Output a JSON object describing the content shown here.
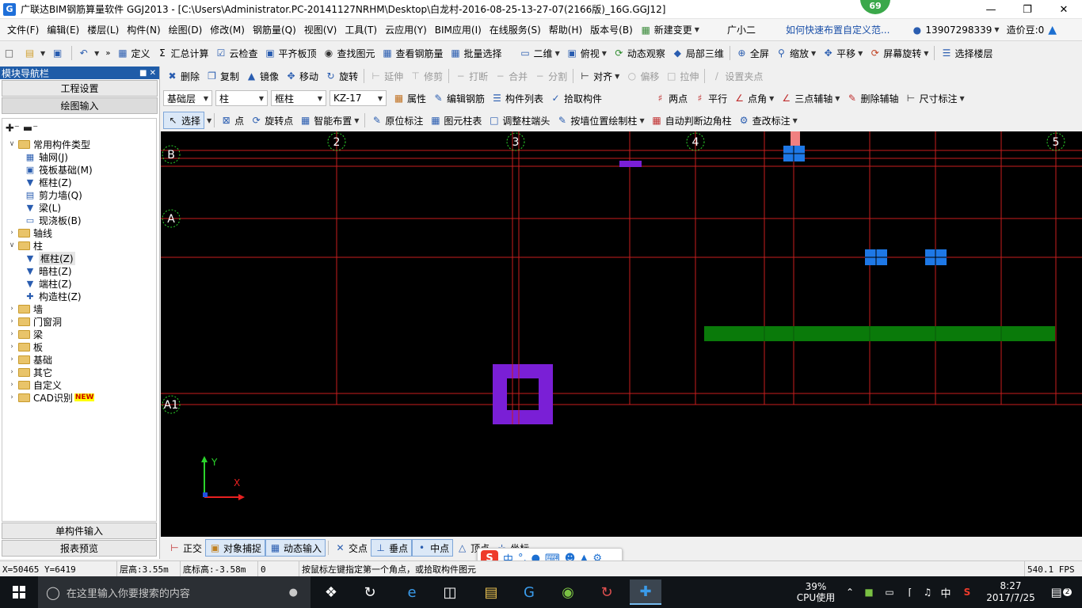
{
  "window": {
    "title": "广联达BIM钢筋算量软件 GGJ2013 - [C:\\Users\\Administrator.PC-20141127NRHM\\Desktop\\白龙村-2016-08-25-13-27-07(2166版)_16G.GGJ12]",
    "app_icon_glyph": "G",
    "badge": "69"
  },
  "menu": {
    "items": [
      "文件(F)",
      "编辑(E)",
      "楼层(L)",
      "构件(N)",
      "绘图(D)",
      "修改(M)",
      "钢筋量(Q)",
      "视图(V)",
      "工具(T)",
      "云应用(Y)",
      "BIM应用(I)",
      "在线服务(S)",
      "帮助(H)",
      "版本号(B)"
    ],
    "new_change": "新建变更",
    "assistant": "广小二",
    "tip_link": "如何快速布置自定义范...",
    "phone": "13907298339",
    "cost_beans": "造价豆:0"
  },
  "toolbar1": {
    "define": "定义",
    "calc": "汇总计算",
    "cloud_check": "云检查",
    "flat_top": "平齐板顶",
    "find": "查找图元",
    "view_rebar": "查看钢筋量",
    "batch_select": "批量选择",
    "view2d": "二维",
    "top_view": "俯视",
    "dyn_observe": "动态观察",
    "local3d": "局部三维",
    "fullscreen": "全屏",
    "zoom": "缩放",
    "pan": "平移",
    "rotate_screen": "屏幕旋转",
    "select_floor": "选择楼层"
  },
  "toolbar2": {
    "delete": "删除",
    "copy": "复制",
    "mirror": "镜像",
    "move": "移动",
    "rotate": "旋转",
    "extend": "延伸",
    "trim": "修剪",
    "break": "打断",
    "merge": "合并",
    "split": "分割",
    "align": "对齐",
    "offset": "偏移",
    "stretch": "拉伸",
    "set_grip": "设置夹点"
  },
  "toolbar3": {
    "floor": "基础层",
    "comp_type": "柱",
    "comp_sub": "框柱",
    "comp_name": "KZ-17",
    "props": "属性",
    "edit_rebar": "编辑钢筋",
    "comp_list": "构件列表",
    "pick": "拾取构件",
    "two_pts": "两点",
    "parallel": "平行",
    "pt_angle": "点角",
    "three_pt_axis": "三点辅轴",
    "del_aux": "删除辅轴",
    "dim": "尺寸标注"
  },
  "toolbar4": {
    "select": "选择",
    "point": "点",
    "rotate_point": "旋转点",
    "smart_layout": "智能布置",
    "in_place_mark": "原位标注",
    "elem_table": "图元柱表",
    "adjust_col_end": "调整柱端头",
    "draw_by_wall": "按墙位置绘制柱",
    "auto_corner": "自动判断边角柱",
    "modify_mark": "查改标注"
  },
  "nav": {
    "header": "模块导航栏",
    "tabs": [
      "工程设置",
      "绘图输入"
    ],
    "tree": [
      {
        "label": "常用构件类型",
        "level": 0,
        "kind": "folder",
        "expanded": true
      },
      {
        "label": "轴网(J)",
        "level": 1,
        "kind": "comp",
        "icon": "grid-icon"
      },
      {
        "label": "筏板基础(M)",
        "level": 1,
        "kind": "comp",
        "icon": "raft-icon"
      },
      {
        "label": "框柱(Z)",
        "level": 1,
        "kind": "comp",
        "icon": "column-icon"
      },
      {
        "label": "剪力墙(Q)",
        "level": 1,
        "kind": "comp",
        "icon": "wall-icon"
      },
      {
        "label": "梁(L)",
        "level": 1,
        "kind": "comp",
        "icon": "beam-icon"
      },
      {
        "label": "现浇板(B)",
        "level": 1,
        "kind": "comp",
        "icon": "slab-icon"
      },
      {
        "label": "轴线",
        "level": 0,
        "kind": "folder",
        "expanded": false
      },
      {
        "label": "柱",
        "level": 0,
        "kind": "folder",
        "expanded": true
      },
      {
        "label": "框柱(Z)",
        "level": 1,
        "kind": "comp",
        "icon": "column-icon",
        "selected": true
      },
      {
        "label": "暗柱(Z)",
        "level": 1,
        "kind": "comp",
        "icon": "column-icon"
      },
      {
        "label": "端柱(Z)",
        "level": 1,
        "kind": "comp",
        "icon": "column-icon"
      },
      {
        "label": "构造柱(Z)",
        "level": 1,
        "kind": "comp",
        "icon": "construct-column-icon"
      },
      {
        "label": "墙",
        "level": 0,
        "kind": "folder",
        "expanded": false
      },
      {
        "label": "门窗洞",
        "level": 0,
        "kind": "folder",
        "expanded": false
      },
      {
        "label": "梁",
        "level": 0,
        "kind": "folder",
        "expanded": false
      },
      {
        "label": "板",
        "level": 0,
        "kind": "folder",
        "expanded": false
      },
      {
        "label": "基础",
        "level": 0,
        "kind": "folder",
        "expanded": false
      },
      {
        "label": "其它",
        "level": 0,
        "kind": "folder",
        "expanded": false
      },
      {
        "label": "自定义",
        "level": 0,
        "kind": "folder",
        "expanded": false
      },
      {
        "label": "CAD识别",
        "level": 0,
        "kind": "folder",
        "expanded": false,
        "new": "NEW"
      }
    ],
    "bottom_tabs": [
      "单构件输入",
      "报表预览"
    ]
  },
  "canvas": {
    "axis_labels": {
      "top": [
        "2",
        "3",
        "4",
        "5"
      ],
      "left": [
        "B",
        "A",
        "A1"
      ]
    },
    "ucs": {
      "x": "X",
      "y": "Y"
    },
    "colors": {
      "grid": "#c81e1e",
      "column_blue": "#1e78e6",
      "purple": "#7a1fd6",
      "green": "#0a7a0a",
      "pink": "#f08080"
    }
  },
  "snap": {
    "ortho": "正交",
    "obj_snap": "对象捕捉",
    "dyn_input": "动态输入",
    "intersect": "交点",
    "perp": "垂点",
    "mid": "中点",
    "vertex": "顶点",
    "coord": "坐标"
  },
  "ime": {
    "lang": "中",
    "punct": "°,"
  },
  "status": {
    "coords": "X=50465 Y=6419",
    "floor_h": "层高:3.55m",
    "bottom_h": "底标高:-3.58m",
    "zero": "0",
    "hint": "按鼠标左键指定第一个角点，或拾取构件图元",
    "fps": "540.1 FPS"
  },
  "taskbar": {
    "search_placeholder": "在这里输入你要搜索的内容",
    "cpu_pct": "39%",
    "cpu_label": "CPU使用",
    "ime_lang": "中",
    "time": "8:27",
    "date": "2017/7/25",
    "notif": "2"
  }
}
